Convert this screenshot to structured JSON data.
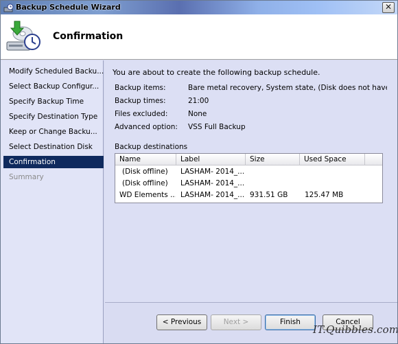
{
  "window": {
    "title": "Backup Schedule Wizard",
    "close_label": "✕"
  },
  "header": {
    "title": "Confirmation"
  },
  "sidebar": {
    "items": [
      {
        "label": "Modify Scheduled Backu...",
        "state": "normal"
      },
      {
        "label": "Select Backup Configur...",
        "state": "normal"
      },
      {
        "label": "Specify Backup Time",
        "state": "normal"
      },
      {
        "label": "Specify Destination Type",
        "state": "normal"
      },
      {
        "label": "Keep or Change Backu...",
        "state": "normal"
      },
      {
        "label": "Select Destination Disk",
        "state": "normal"
      },
      {
        "label": "Confirmation",
        "state": "active"
      },
      {
        "label": "Summary",
        "state": "disabled"
      }
    ]
  },
  "main": {
    "intro": "You are about to create the following backup schedule.",
    "info": [
      {
        "label": "Backup items:",
        "value": "Bare metal recovery, System state, (Disk does not have..."
      },
      {
        "label": "Backup times:",
        "value": "21:00"
      },
      {
        "label": "Files excluded:",
        "value": "None"
      },
      {
        "label": "Advanced option:",
        "value": "VSS Full Backup"
      }
    ],
    "destinations_label": "Backup destinations",
    "table": {
      "columns": [
        "Name",
        "Label",
        "Size",
        "Used Space"
      ],
      "rows": [
        [
          "(Disk offline)",
          "LASHAM- 2014_...",
          "",
          ""
        ],
        [
          "(Disk offline)",
          "LASHAM- 2014_...",
          "",
          ""
        ],
        [
          "WD Elements ...",
          "LASHAM- 2014_...",
          "931.51 GB",
          "125.47 MB"
        ]
      ]
    }
  },
  "buttons": {
    "previous": "< Previous",
    "next": "Next >",
    "finish": "Finish",
    "cancel": "Cancel"
  },
  "watermark": "IT.Quibbles.com"
}
